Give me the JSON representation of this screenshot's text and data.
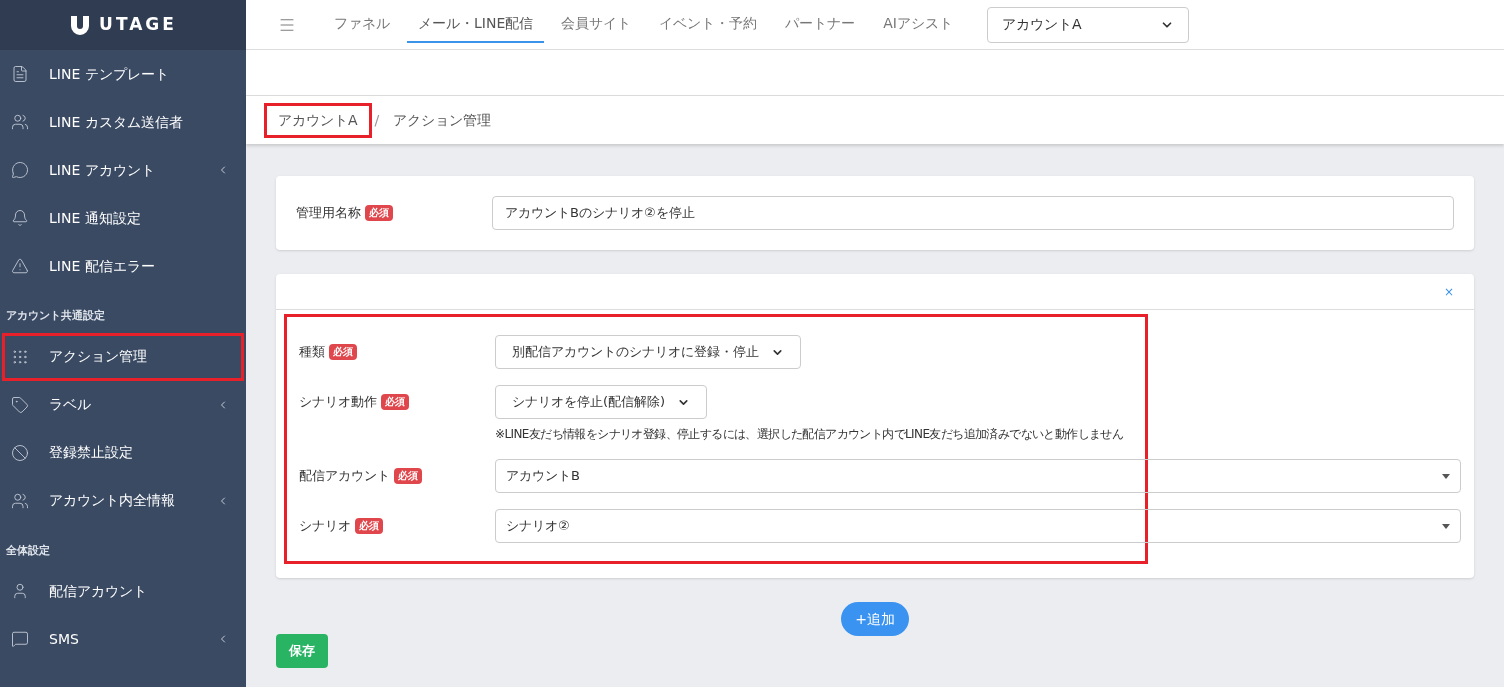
{
  "logo": {
    "text": "UTAGE"
  },
  "nav": {
    "items": [
      {
        "label": "ファネル",
        "selected": false
      },
      {
        "label": "メール・LINE配信",
        "selected": true
      },
      {
        "label": "会員サイト",
        "selected": false
      },
      {
        "label": "イベント・予約",
        "selected": false
      },
      {
        "label": "パートナー",
        "selected": false
      },
      {
        "label": "AIアシスト",
        "selected": false
      }
    ],
    "account_select": {
      "value": "アカウントA"
    }
  },
  "sidebar": {
    "sections": [
      {
        "items": [
          {
            "label": "LINE テンプレート",
            "expandable": false,
            "highlighted": false
          },
          {
            "label": "LINE カスタム送信者",
            "expandable": false,
            "highlighted": false
          },
          {
            "label": "LINE アカウント",
            "expandable": true,
            "highlighted": false
          },
          {
            "label": "LINE 通知設定",
            "expandable": false,
            "highlighted": false
          },
          {
            "label": "LINE 配信エラー",
            "expandable": false,
            "highlighted": false
          }
        ]
      },
      {
        "heading": "アカウント共通設定",
        "items": [
          {
            "label": "アクション管理",
            "expandable": false,
            "highlighted": true
          },
          {
            "label": "ラベル",
            "expandable": true,
            "highlighted": false
          },
          {
            "label": "登録禁止設定",
            "expandable": false,
            "highlighted": false
          },
          {
            "label": "アカウント内全情報",
            "expandable": true,
            "highlighted": false
          }
        ]
      },
      {
        "heading": "全体設定",
        "items": [
          {
            "label": "配信アカウント",
            "expandable": false,
            "highlighted": false
          },
          {
            "label": "SMS",
            "expandable": true,
            "highlighted": false
          }
        ]
      }
    ]
  },
  "breadcrumb_separator": "/",
  "breadcrumb": [
    {
      "label": "アカウントA",
      "highlighted": true
    },
    {
      "label": "アクション管理",
      "highlighted": false
    }
  ],
  "name_card": {
    "label": "管理用名称",
    "required_badge": "必須",
    "value": "アカウントBのシナリオ②を停止"
  },
  "action_card": {
    "close": "×",
    "highlighted": true,
    "fields": [
      {
        "kind": "select",
        "label": "種類",
        "required_badge": "必須",
        "value": "別配信アカウントのシナリオに登録・停止"
      },
      {
        "kind": "select",
        "label": "シナリオ動作",
        "required_badge": "必須",
        "value": "シナリオを停止(配信解除)",
        "note": "※LINE友だち情報をシナリオ登録、停止するには、選択した配信アカウント内でLINE友だち追加済みでないと動作しません"
      },
      {
        "kind": "combo",
        "label": "配信アカウント",
        "required_badge": "必須",
        "value": "アカウントB"
      },
      {
        "kind": "combo",
        "label": "シナリオ",
        "required_badge": "必須",
        "value": "シナリオ②"
      }
    ]
  },
  "add_button": "+追加",
  "save_button": "保存"
}
